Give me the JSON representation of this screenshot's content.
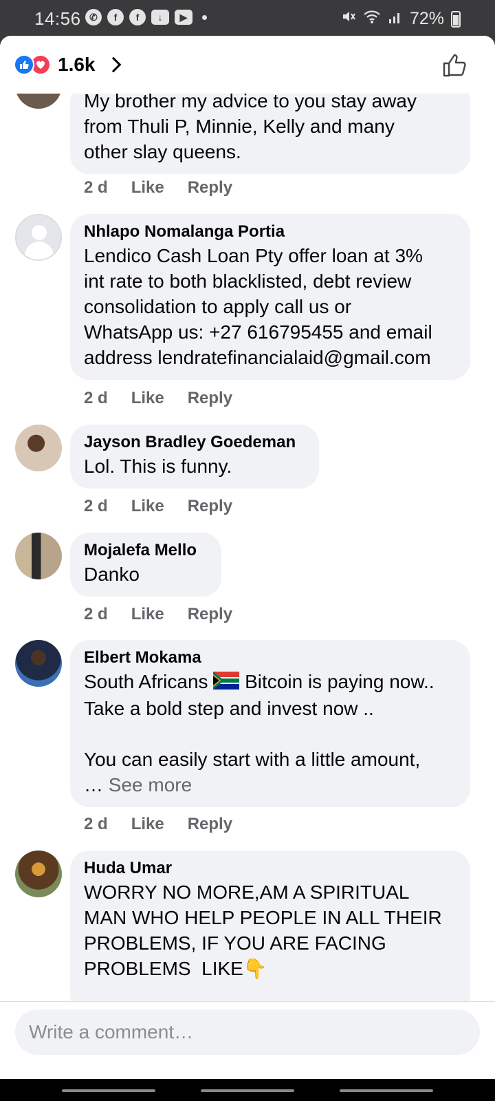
{
  "status_bar": {
    "time": "14:56",
    "battery": "72%"
  },
  "header": {
    "reaction_count": "1.6k"
  },
  "comments": [
    {
      "author": "",
      "text": "My brother my advice to you stay away\nfrom Thuli P, Minnie, Kelly and many\nother slay queens.",
      "time": "2 d",
      "like": "Like",
      "reply": "Reply"
    },
    {
      "author": "Nhlapo Nomalanga Portia",
      "text": "Lendico Cash Loan Pty offer loan at 3%\nint rate to both blacklisted, debt review\nconsolidation to apply call us or\nWhatsApp us: +27 616795455 and email\naddress lendratefinancialaid@gmail.com",
      "time": "2 d",
      "like": "Like",
      "reply": "Reply"
    },
    {
      "author": "Jayson Bradley Goedeman",
      "text": "Lol. This is funny.",
      "time": "2 d",
      "like": "Like",
      "reply": "Reply"
    },
    {
      "author": "Mojalefa Mello",
      "text": "Danko",
      "time": "2 d",
      "like": "Like",
      "reply": "Reply"
    },
    {
      "author": "Elbert Mokama",
      "text_before_flag": "South Africans ",
      "text_after_flag": " Bitcoin is paying now..\nTake a bold step and invest now ..\n\nYou can easily start with a little amount,\n… ",
      "see_more": "See more",
      "time": "2 d",
      "like": "Like",
      "reply": "Reply"
    },
    {
      "author": "Huda Umar",
      "text": "WORRY NO MORE,AM A SPIRITUAL\nMAN WHO HELP PEOPLE IN ALL THEIR\nPROBLEMS, IF YOU ARE FACING\nPROBLEMS  LIKE👇"
    }
  ],
  "composer": {
    "placeholder": "Write a comment…"
  }
}
